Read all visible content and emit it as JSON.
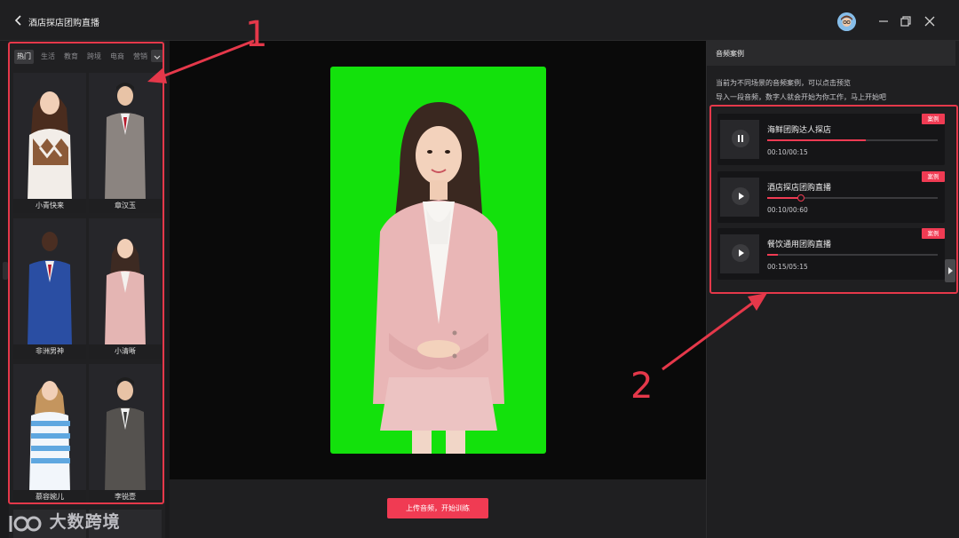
{
  "titlebar": {
    "title": "酒店探店团购直播"
  },
  "left": {
    "tabs": [
      "热门",
      "生活",
      "教育",
      "跨境",
      "电商",
      "营销"
    ],
    "avatars": [
      {
        "name": "小青快来"
      },
      {
        "name": "章汉玉"
      },
      {
        "name": "非洲男神"
      },
      {
        "name": "小清晰"
      },
      {
        "name": "慕容婉儿"
      },
      {
        "name": "李锐壹"
      }
    ]
  },
  "center": {
    "upload_label": "上传音频，开始训练"
  },
  "right": {
    "header": "音频案例",
    "desc1": "当前为不同场景的音频案例，可以点击预览",
    "desc2": "导入一段音频，数字人就会开始为你工作，马上开始吧",
    "audios": [
      {
        "title": "海鲜团购达人探店",
        "time": "00:10/00:15",
        "progress": 0.58,
        "playing": true,
        "tag": "案例"
      },
      {
        "title": "酒店探店团购直播",
        "time": "00:10/00:60",
        "progress": 0.2,
        "playing": false,
        "tag": "案例"
      },
      {
        "title": "餐饮通用团购直播",
        "time": "00:15/05:15",
        "progress": 0.06,
        "playing": false,
        "tag": "案例"
      }
    ]
  },
  "annotations": {
    "callout1": "1",
    "callout2": "2"
  },
  "watermark": "大数跨境",
  "colors": {
    "accent": "#f03b53",
    "green_screen": "#13e10c",
    "annotation_red": "#e5384a"
  }
}
